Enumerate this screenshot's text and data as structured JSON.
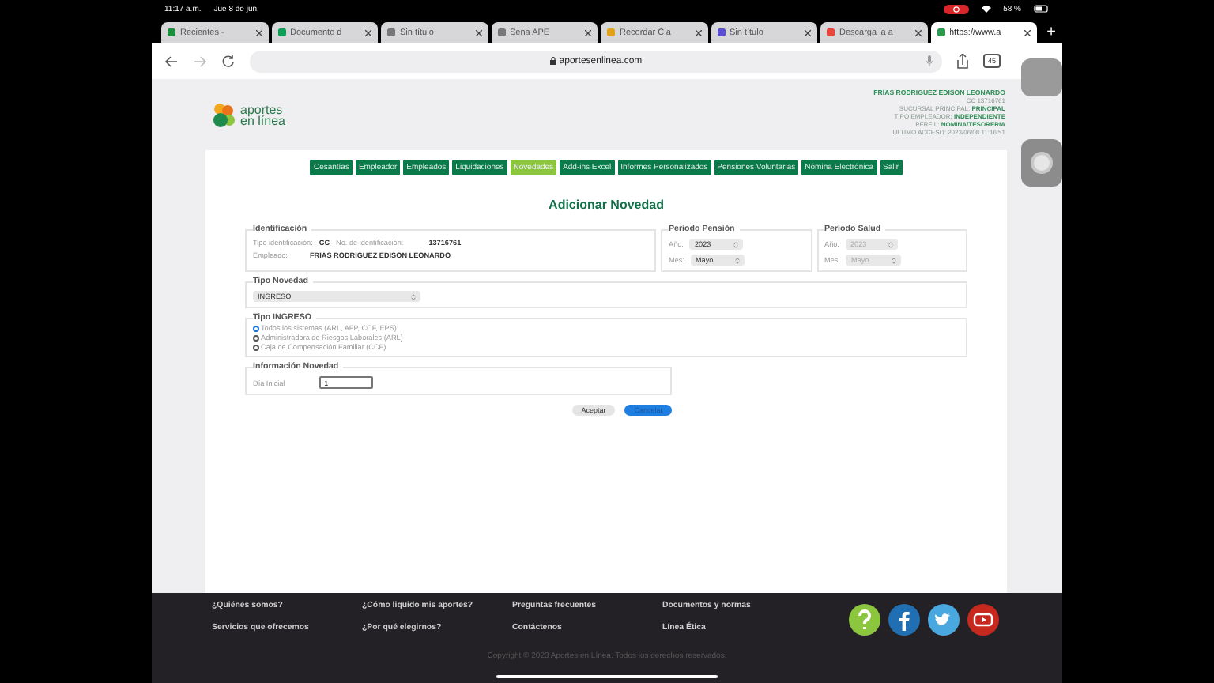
{
  "status_bar": {
    "time": "11:17 a.m.",
    "date": "Jue 8 de jun.",
    "battery": "58 %"
  },
  "browser_tabs": [
    {
      "title": "Recientes -",
      "selected": false
    },
    {
      "title": "Documento d",
      "selected": false
    },
    {
      "title": "Sin título",
      "selected": false
    },
    {
      "title": "Sena APE",
      "selected": false
    },
    {
      "title": "Recordar Cla",
      "selected": false
    },
    {
      "title": "Sin título",
      "selected": false
    },
    {
      "title": "Descarga la a",
      "selected": false
    },
    {
      "title": "https://www.a",
      "selected": true
    }
  ],
  "new_tab": "+",
  "address_bar": {
    "url": "aportesenlinea.com",
    "tab_count": "45"
  },
  "logo": {
    "line_1": "aportes",
    "line_2": "en línea"
  },
  "user_name": "FRIAS RODRIGUEZ EDISON LEONARDO",
  "user_info": [
    {
      "label": "CC 13716761"
    },
    {
      "label": "SUCURSAL PRINCIPAL:",
      "value": "PRINCIPAL"
    },
    {
      "label": "TIPO EMPLEADOR:",
      "value": "INDEPENDIENTE"
    },
    {
      "label": "PERFIL:",
      "value": "NOMINA/TESORERIA"
    },
    {
      "label": "ULTIMO ACCESO: 2023/06/08 11:16:51"
    }
  ],
  "nav": [
    {
      "label": "Cesantías",
      "selected": false
    },
    {
      "label": "Empleador",
      "selected": false
    },
    {
      "label": "Empleados",
      "selected": false
    },
    {
      "label": "Liquidaciones",
      "selected": false
    },
    {
      "label": "Novedades",
      "selected": true
    },
    {
      "label": "Add-ins Excel",
      "selected": false
    },
    {
      "label": "Informes Personalizados",
      "selected": false
    },
    {
      "label": "Pensiones Voluntarias",
      "selected": false
    },
    {
      "label": "Nómina Electrónica",
      "selected": false
    },
    {
      "label": "Salir",
      "selected": false
    }
  ],
  "page_title": "Adicionar Novedad",
  "identificacion": {
    "legend": "Identificación",
    "tipo_label": "Tipo identificación:",
    "tipo_value": "CC",
    "numero_label": "No. de identificación:",
    "numero_value": "13716761",
    "empleado_label": "Empleado:",
    "empleado_value": "FRIAS RODRIGUEZ EDISON LEONARDO"
  },
  "periodos": [
    {
      "legend": "Periodo Pensión",
      "disabled": false,
      "year_label": "Año:",
      "year": "2023",
      "month_label": "Mes:",
      "month": "Mayo"
    },
    {
      "legend": "Periodo Salud",
      "disabled": true,
      "year_label": "Año:",
      "year": "2023",
      "month_label": "Mes:",
      "month": "Mayo"
    }
  ],
  "tipo_novedad": {
    "legend": "Tipo Novedad",
    "value": "INGRESO"
  },
  "tipo_ingreso": {
    "legend": "Tipo INGRESO",
    "options": [
      {
        "label": "Todos los sistemas (ARL, AFP, CCF, EPS)",
        "selected": true
      },
      {
        "label": "Administradora de Riesgos Laborales (ARL)",
        "selected": false
      },
      {
        "label": "Caja de Compensación Familiar (CCF)",
        "selected": false
      }
    ]
  },
  "informacion": {
    "legend": "Información Novedad",
    "dia_label": "Día Inicial",
    "dia_value": "1"
  },
  "buttons": [
    {
      "label": "Aceptar",
      "kind": "secondary"
    },
    {
      "label": "Cancelar",
      "kind": "primary"
    }
  ],
  "footer": {
    "links": [
      "¿Quiénes somos?",
      "¿Cómo liquido mis aportes?",
      "Preguntas frecuentes",
      "Documentos y normas",
      "Servicios que ofrecemos",
      "¿Por qué elegirnos?",
      "Contáctenos",
      "Línea Ética"
    ],
    "copyright": "Copyright © 2023 Aportes en Línea. Todos los derechos reservados."
  }
}
